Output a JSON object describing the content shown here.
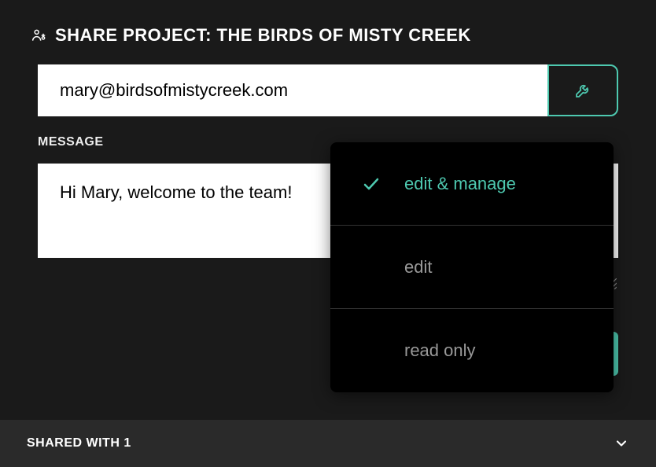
{
  "header": {
    "title": "SHARE PROJECT: THE BIRDS OF MISTY CREEK"
  },
  "email": {
    "value": "mary@birdsofmistycreek.com",
    "placeholder": ""
  },
  "message": {
    "label": "MESSAGE",
    "value": "Hi Mary, welcome to the team!"
  },
  "permissions": {
    "options": [
      {
        "label": "edit & manage",
        "selected": true
      },
      {
        "label": "edit",
        "selected": false
      },
      {
        "label": "read only",
        "selected": false
      }
    ]
  },
  "footer": {
    "text": "SHARED WITH 1"
  }
}
